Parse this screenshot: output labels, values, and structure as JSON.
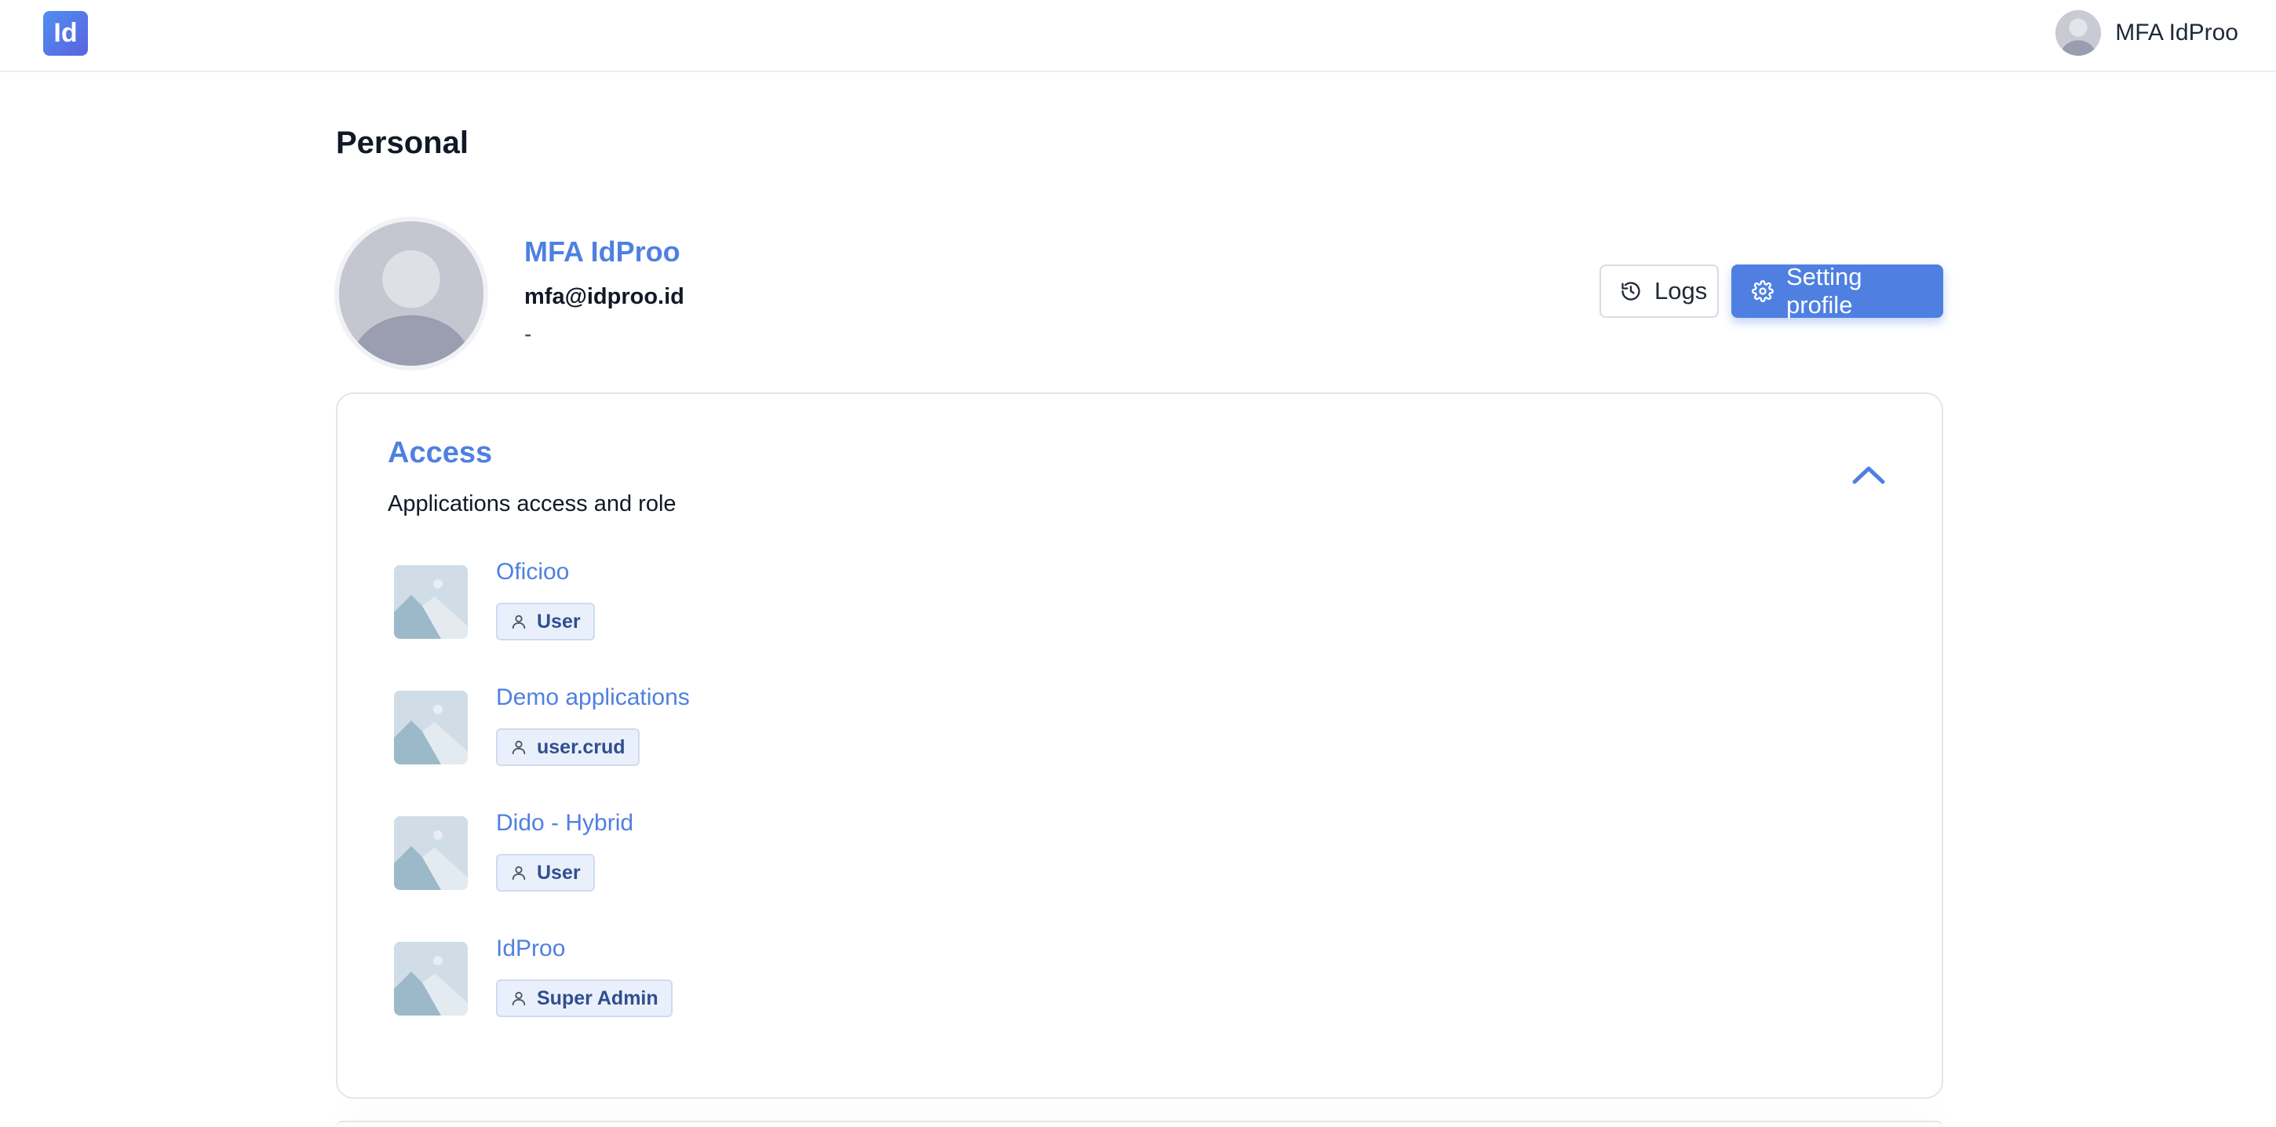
{
  "header": {
    "logo_text": "Id",
    "user_name": "MFA IdProo"
  },
  "page": {
    "title": "Personal"
  },
  "profile": {
    "name": "MFA IdProo",
    "email": "mfa@idproo.id",
    "extra": "-",
    "logs_label": "Logs",
    "setting_label": "Setting profile"
  },
  "access": {
    "title": "Access",
    "subtitle": "Applications access and role",
    "apps": [
      {
        "name": "Oficioo",
        "role": "User"
      },
      {
        "name": "Demo applications",
        "role": "user.crud"
      },
      {
        "name": "Dido - Hybrid",
        "role": "User"
      },
      {
        "name": "IdProo",
        "role": "Super Admin"
      }
    ]
  },
  "icons": {
    "logs": "history-icon",
    "setting": "gear-icon",
    "collapse": "chevron-up-icon",
    "role": "user-icon",
    "app_thumbnail": "image-placeholder-icon"
  },
  "colors": {
    "accent": "#4f80e1",
    "badge_bg": "#eaf0fb",
    "logo_gradient_start": "#4f8ff0",
    "logo_gradient_end": "#5b62e0"
  }
}
